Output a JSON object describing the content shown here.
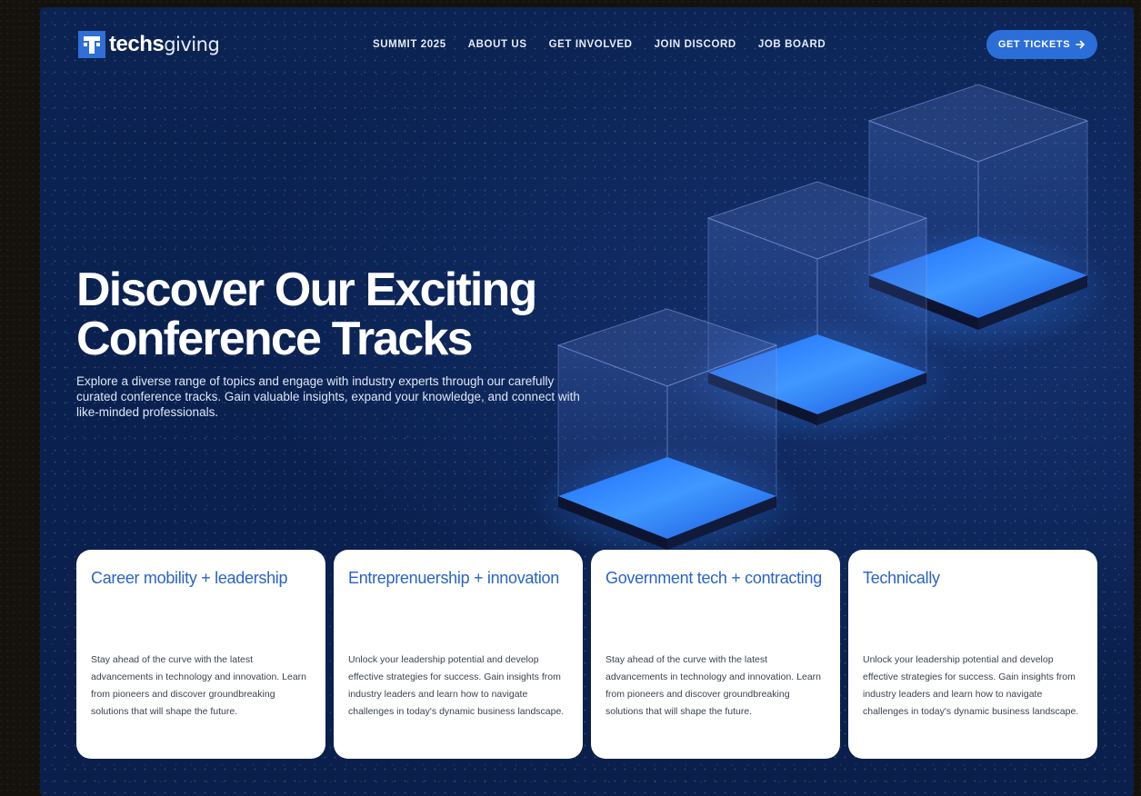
{
  "brand": {
    "name_bold": "techs",
    "name_light": "giving",
    "logo_color": "#2f6fd6"
  },
  "nav": {
    "items": [
      "SUMMIT 2025",
      "ABOUT US",
      "GET INVOLVED",
      "JOIN DISCORD",
      "JOB BOARD"
    ],
    "cta_label": "GET TICKETS",
    "cta_icon": "arrow-right-icon",
    "cta_color": "#2c6ed8"
  },
  "hero": {
    "title_line1": "Discover Our Exciting",
    "title_line2": "Conference Tracks",
    "description": "Explore a diverse range of topics and engage with industry experts through our carefully curated conference tracks. Gain valuable insights, expand your knowledge, and connect with like-minded professionals."
  },
  "tracks": [
    {
      "title": "Career mobility + leadership",
      "text": "Stay ahead of the curve with the latest advancements in technology and innovation. Learn from pioneers and discover groundbreaking solutions that will shape the future."
    },
    {
      "title": "Entreprenuership + innovation",
      "text": "Unlock your leadership potential and develop effective strategies for success. Gain insights from industry leaders and learn how to navigate challenges in today's dynamic business landscape."
    },
    {
      "title": "Government tech + contracting",
      "text": "Stay ahead of the curve with the latest advancements in technology and innovation. Learn from pioneers and discover groundbreaking solutions that will shape the future."
    },
    {
      "title": "Technically",
      "text": "Unlock your leadership potential and develop effective strategies for success. Gain insights from industry leaders and learn how to navigate challenges in today's dynamic business landscape."
    }
  ],
  "colors": {
    "background": "#0a2150",
    "card_title": "#2a63c7",
    "glow": "#3a8cff"
  }
}
